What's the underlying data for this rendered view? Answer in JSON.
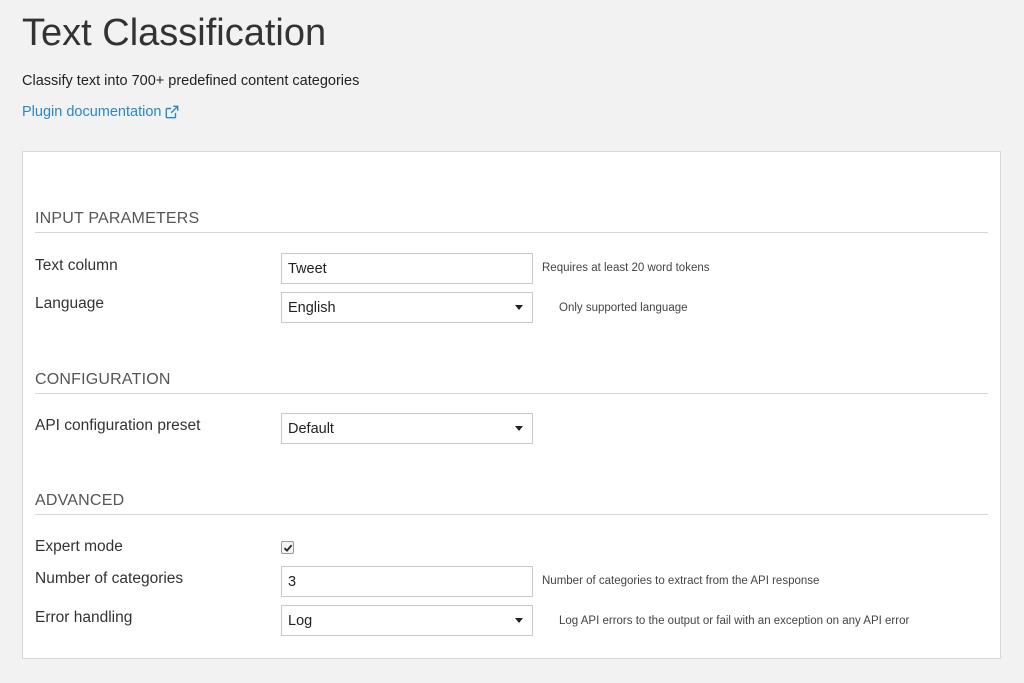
{
  "header": {
    "title": "Text Classification",
    "subtitle": "Classify text into 700+ predefined content categories",
    "doc_link": "Plugin documentation",
    "doc_link_icon": "external-link-icon"
  },
  "sections": {
    "input": {
      "title": "INPUT PARAMETERS",
      "text_column": {
        "label": "Text column",
        "value": "Tweet",
        "help": "Requires at least 20 word tokens"
      },
      "language": {
        "label": "Language",
        "value": "English",
        "help": "Only supported language"
      }
    },
    "configuration": {
      "title": "CONFIGURATION",
      "preset": {
        "label": "API configuration preset",
        "value": "Default"
      }
    },
    "advanced": {
      "title": "ADVANCED",
      "expert_mode": {
        "label": "Expert mode",
        "checked": true
      },
      "num_categories": {
        "label": "Number of categories",
        "value": "3",
        "help": "Number of categories to extract from the API response"
      },
      "error_handling": {
        "label": "Error handling",
        "value": "Log",
        "help": "Log API errors to the output or fail with an exception on any API error"
      }
    }
  },
  "colors": {
    "link": "#2a87c8",
    "background": "#f2f2f2",
    "panel": "#ffffff"
  }
}
